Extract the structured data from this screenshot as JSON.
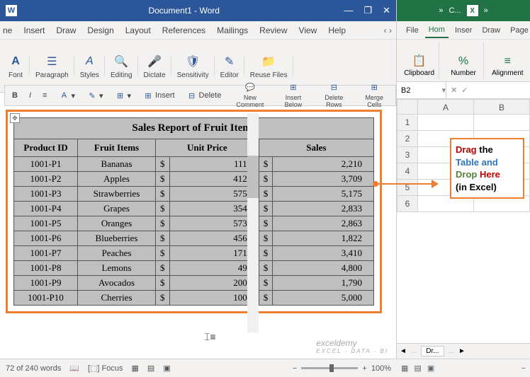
{
  "word": {
    "title": "Document1 - Word",
    "tabs": [
      "ne",
      "Insert",
      "Draw",
      "Design",
      "Layout",
      "References",
      "Mailings",
      "Review",
      "View",
      "Help"
    ],
    "ribbon_groups": [
      {
        "label": "Font",
        "icon": "A"
      },
      {
        "label": "Paragraph",
        "icon": "¶"
      },
      {
        "label": "Styles",
        "icon": "A"
      },
      {
        "label": "Editing",
        "icon": "🔍"
      },
      {
        "label": "Dictate",
        "icon": "🎤"
      },
      {
        "label": "Sensitivity",
        "icon": "🛡"
      },
      {
        "label": "Editor",
        "icon": "✎"
      },
      {
        "label": "Reuse Files",
        "icon": "📁"
      }
    ],
    "secondary": {
      "insert": "Insert",
      "delete": "Delete",
      "new_comment": "New Comment",
      "insert_below": "Insert Below",
      "delete_rows": "Delete Rows",
      "merge_cells": "Merge Cells"
    },
    "status": {
      "words": "72 of 240 words",
      "focus": "Focus",
      "zoom": "100%"
    }
  },
  "table": {
    "title": "Sales Report of Fruit Items",
    "headers": [
      "Product ID",
      "Fruit Items",
      "Unit Price",
      "Sales"
    ],
    "rows": [
      {
        "id": "1001-P1",
        "fruit": "Bananas",
        "price": "111",
        "sales": "2,210"
      },
      {
        "id": "1001-P2",
        "fruit": "Apples",
        "price": "412",
        "sales": "3,709"
      },
      {
        "id": "1001-P3",
        "fruit": "Strawberries",
        "price": "575",
        "sales": "5,175"
      },
      {
        "id": "1001-P4",
        "fruit": "Grapes",
        "price": "354",
        "sales": "2,833"
      },
      {
        "id": "1001-P5",
        "fruit": "Oranges",
        "price": "573",
        "sales": "2,863"
      },
      {
        "id": "1001-P6",
        "fruit": "Blueberries",
        "price": "456",
        "sales": "1,822"
      },
      {
        "id": "1001-P7",
        "fruit": "Peaches",
        "price": "171",
        "sales": "3,410"
      },
      {
        "id": "1001-P8",
        "fruit": "Lemons",
        "price": "49",
        "sales": "4,800"
      },
      {
        "id": "1001-P9",
        "fruit": "Avocados",
        "price": "200",
        "sales": "1,790"
      },
      {
        "id": "1001-P10",
        "fruit": "Cherries",
        "price": "100",
        "sales": "5,000"
      }
    ]
  },
  "excel": {
    "title_short": "C...",
    "tabs": [
      "File",
      "Hom",
      "Inser",
      "Draw",
      "Page"
    ],
    "ribbon": [
      "Clipboard",
      "Number",
      "Alignment"
    ],
    "namebox": "B2",
    "cols": [
      "A",
      "B"
    ],
    "rows": [
      "1",
      "2",
      "3",
      "4",
      "5",
      "6"
    ],
    "sheet": "Dr..."
  },
  "callout": {
    "l1": "Drag",
    "l1b": "the",
    "l2": "Table and",
    "l3a": "Drop",
    "l3b": "Here",
    "l4": "(in Excel)"
  },
  "watermark": {
    "main": "exceldemy",
    "sub": "EXCEL · DATA · BI"
  }
}
